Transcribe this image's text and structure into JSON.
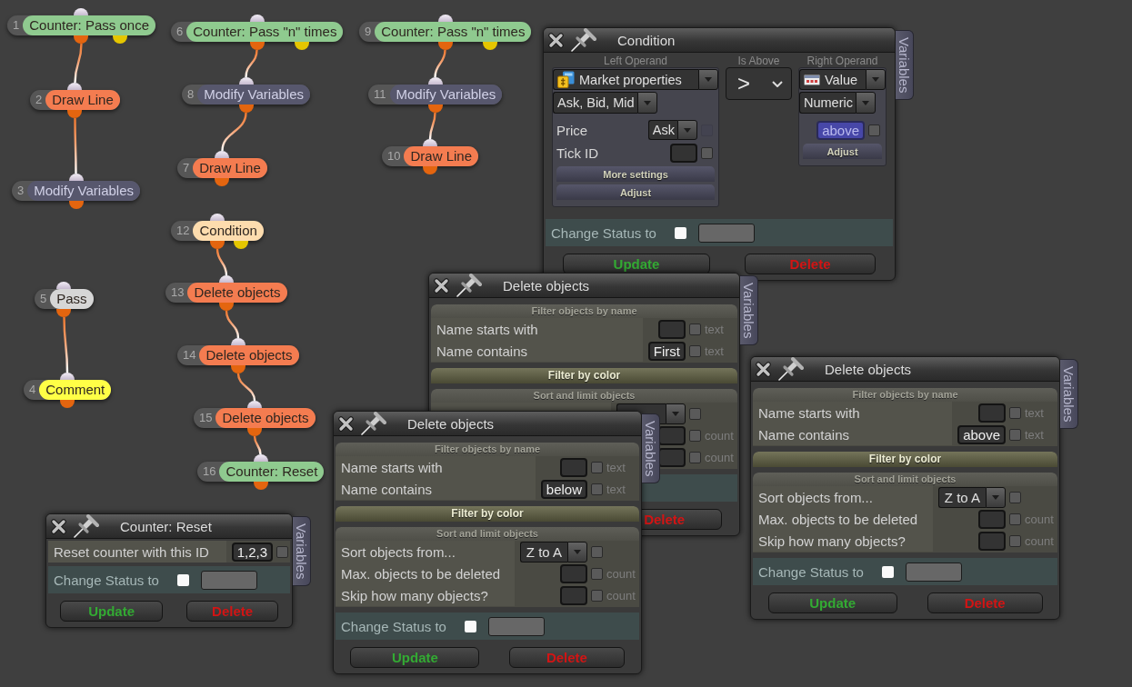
{
  "canvas": {
    "flows": [
      {
        "nodes": [
          {
            "number": "1",
            "label": "Counter: Pass once",
            "color": "#8fca8f",
            "second_output": true
          },
          {
            "number": "2",
            "label": "Draw Line",
            "color": "#f47c50",
            "second_output": false
          },
          {
            "number": "3",
            "label": "Modify Variables",
            "color": "#57576d",
            "second_output": false
          }
        ]
      },
      {
        "nodes": [
          {
            "number": "6",
            "label": "Counter: Pass \"n\" times",
            "color": "#8fca8f",
            "second_output": true
          },
          {
            "number": "8",
            "label": "Modify Variables",
            "color": "#57576d",
            "second_output": false
          },
          {
            "number": "7",
            "label": "Draw Line",
            "color": "#f47c50",
            "second_output": false
          }
        ]
      },
      {
        "nodes": [
          {
            "number": "9",
            "label": "Counter: Pass \"n\" times",
            "color": "#8fca8f",
            "second_output": true
          },
          {
            "number": "11",
            "label": "Modify Variables",
            "color": "#57576d",
            "second_output": false
          },
          {
            "number": "10",
            "label": "Draw Line",
            "color": "#f47c50",
            "second_output": false
          }
        ]
      },
      {
        "nodes": [
          {
            "number": "5",
            "label": "Pass",
            "color": "#d6d6d6",
            "second_output": false
          },
          {
            "number": "4",
            "label": "Comment",
            "color": "#ffff46",
            "second_output": false
          }
        ]
      },
      {
        "nodes": [
          {
            "number": "12",
            "label": "Condition",
            "color": "#fddcae",
            "second_output": true
          },
          {
            "number": "13",
            "label": "Delete objects",
            "color": "#f47c50",
            "second_output": false
          },
          {
            "number": "14",
            "label": "Delete objects",
            "color": "#f47c50",
            "second_output": false
          },
          {
            "number": "15",
            "label": "Delete objects",
            "color": "#f47c50",
            "second_output": false
          },
          {
            "number": "16",
            "label": "Counter: Reset",
            "color": "#8fca8f",
            "second_output": false
          }
        ]
      }
    ]
  },
  "windows": [
    {
      "kind": "condition",
      "title": "Condition",
      "side_tab": "Variables",
      "columns": [
        {
          "kind": "operand",
          "heading": "Left Operand",
          "source": "Market properties",
          "subtype": "Ask, Bid, Mid",
          "rows": [
            {
              "label": "Price",
              "controls": [
                {
                  "kind": "dropdown",
                  "value": "Ask"
                },
                {
                  "kind": "checkbox",
                  "checked": false,
                  "disabled": true
                }
              ]
            },
            {
              "label": "Tick ID",
              "controls": [
                {
                  "kind": "input",
                  "highlighted": false
                },
                {
                  "kind": "checkbox",
                  "checked": false,
                  "disabled": false
                }
              ]
            }
          ],
          "buttons": [
            "More settings",
            "Adjust"
          ]
        },
        {
          "kind": "operator",
          "heading": "Is Above",
          "value": ">"
        },
        {
          "kind": "operand",
          "heading": "Right Operand",
          "source": "Value",
          "subtype": "Numeric",
          "rows": [
            {
              "controls": [
                {
                  "kind": "input",
                  "value": "above",
                  "highlighted": true
                },
                {
                  "kind": "checkbox",
                  "checked": false,
                  "disabled": false
                }
              ]
            }
          ],
          "buttons": [
            "Adjust"
          ]
        }
      ],
      "status": {
        "label": "Change Status to",
        "checked": false
      },
      "buttons": [
        {
          "kind": "update",
          "label": "Update"
        },
        {
          "kind": "delete",
          "label": "Delete"
        }
      ]
    },
    {
      "kind": "form",
      "title": "Delete objects",
      "side_tab": "Variables",
      "sections": [
        {
          "title": "Filter objects by name",
          "expanded": true,
          "rows": [
            {
              "label": "Name starts with",
              "controls": [
                {
                  "kind": "input",
                  "highlighted": false
                },
                {
                  "kind": "checkbox",
                  "checked": false,
                  "disabled": false
                },
                {
                  "kind": "hint",
                  "text": "text"
                }
              ]
            },
            {
              "label": "Name contains",
              "controls": [
                {
                  "kind": "input",
                  "value": "First",
                  "highlighted": false
                },
                {
                  "kind": "checkbox",
                  "checked": false,
                  "disabled": false
                },
                {
                  "kind": "hint",
                  "text": "text"
                }
              ]
            }
          ]
        },
        {
          "title": "Filter by color",
          "expanded": false
        },
        {
          "title": "Sort and limit objects",
          "expanded": true,
          "rows": [
            {
              "controls": [
                {
                  "kind": "dropdown"
                },
                {
                  "kind": "checkbox",
                  "checked": false,
                  "disabled": false
                }
              ]
            },
            {
              "controls": [
                {
                  "kind": "input",
                  "highlighted": false
                },
                {
                  "kind": "checkbox",
                  "checked": false,
                  "disabled": false
                },
                {
                  "kind": "hint",
                  "text": "count"
                }
              ]
            },
            {
              "controls": [
                {
                  "kind": "input",
                  "highlighted": false
                },
                {
                  "kind": "checkbox",
                  "checked": false,
                  "disabled": false
                },
                {
                  "kind": "hint",
                  "text": "count"
                }
              ]
            }
          ]
        }
      ],
      "buttons": [
        {
          "kind": "delete",
          "label": "Delete"
        }
      ]
    },
    {
      "kind": "form",
      "title": "Delete objects",
      "side_tab": "Variables",
      "sections": [
        {
          "title": "Filter objects by name",
          "expanded": true,
          "rows": [
            {
              "label": "Name starts with",
              "controls": [
                {
                  "kind": "input",
                  "highlighted": false
                },
                {
                  "kind": "checkbox",
                  "checked": false,
                  "disabled": false
                },
                {
                  "kind": "hint",
                  "text": "text"
                }
              ]
            },
            {
              "label": "Name contains",
              "controls": [
                {
                  "kind": "input",
                  "value": "above",
                  "highlighted": false
                },
                {
                  "kind": "checkbox",
                  "checked": false,
                  "disabled": false
                },
                {
                  "kind": "hint",
                  "text": "text"
                }
              ]
            }
          ]
        },
        {
          "title": "Filter by color",
          "expanded": false
        },
        {
          "title": "Sort and limit objects",
          "expanded": true,
          "rows": [
            {
              "label": "Sort objects from...",
              "controls": [
                {
                  "kind": "dropdown",
                  "value": "Z to A"
                },
                {
                  "kind": "checkbox",
                  "checked": false,
                  "disabled": false
                }
              ]
            },
            {
              "label": "Max. objects to be deleted",
              "controls": [
                {
                  "kind": "input",
                  "highlighted": false
                },
                {
                  "kind": "checkbox",
                  "checked": false,
                  "disabled": false
                },
                {
                  "kind": "hint",
                  "text": "count"
                }
              ]
            },
            {
              "label": "Skip how many objects?",
              "controls": [
                {
                  "kind": "input",
                  "highlighted": false
                },
                {
                  "kind": "checkbox",
                  "checked": false,
                  "disabled": false
                },
                {
                  "kind": "hint",
                  "text": "count"
                }
              ]
            }
          ]
        }
      ],
      "status": {
        "label": "Change Status to",
        "checked": false
      },
      "buttons": [
        {
          "kind": "update",
          "label": "Update"
        },
        {
          "kind": "delete",
          "label": "Delete"
        }
      ]
    },
    {
      "kind": "form",
      "title": "Delete objects",
      "side_tab": "Variables",
      "sections": [
        {
          "title": "Filter objects by name",
          "expanded": true,
          "rows": [
            {
              "label": "Name starts with",
              "controls": [
                {
                  "kind": "input",
                  "highlighted": false
                },
                {
                  "kind": "checkbox",
                  "checked": false,
                  "disabled": false
                },
                {
                  "kind": "hint",
                  "text": "text"
                }
              ]
            },
            {
              "label": "Name contains",
              "controls": [
                {
                  "kind": "input",
                  "value": "below",
                  "highlighted": false
                },
                {
                  "kind": "checkbox",
                  "checked": false,
                  "disabled": false
                },
                {
                  "kind": "hint",
                  "text": "text"
                }
              ]
            }
          ]
        },
        {
          "title": "Filter by color",
          "expanded": false
        },
        {
          "title": "Sort and limit objects",
          "expanded": true,
          "rows": [
            {
              "label": "Sort objects from...",
              "controls": [
                {
                  "kind": "dropdown",
                  "value": "Z to A"
                },
                {
                  "kind": "checkbox",
                  "checked": false,
                  "disabled": false
                }
              ]
            },
            {
              "label": "Max. objects to be deleted",
              "controls": [
                {
                  "kind": "input",
                  "highlighted": false
                },
                {
                  "kind": "checkbox",
                  "checked": false,
                  "disabled": false
                },
                {
                  "kind": "hint",
                  "text": "count"
                }
              ]
            },
            {
              "label": "Skip how many objects?",
              "controls": [
                {
                  "kind": "input",
                  "highlighted": false
                },
                {
                  "kind": "checkbox",
                  "checked": false,
                  "disabled": false
                },
                {
                  "kind": "hint",
                  "text": "count"
                }
              ]
            }
          ]
        }
      ],
      "status": {
        "label": "Change Status to",
        "checked": false
      },
      "buttons": [
        {
          "kind": "update",
          "label": "Update"
        },
        {
          "kind": "delete",
          "label": "Delete"
        }
      ]
    },
    {
      "kind": "form",
      "title": "Counter: Reset",
      "side_tab": "Variables",
      "sections": [
        {
          "rows": [
            {
              "label": "Reset counter with this ID",
              "controls": [
                {
                  "kind": "input",
                  "value": "1,2,3",
                  "highlighted": false
                },
                {
                  "kind": "checkbox",
                  "checked": false,
                  "disabled": false
                }
              ]
            }
          ]
        }
      ],
      "status": {
        "label": "Change Status to",
        "checked": false
      },
      "buttons": [
        {
          "kind": "update",
          "label": "Update"
        },
        {
          "kind": "delete",
          "label": "Delete"
        }
      ]
    }
  ]
}
